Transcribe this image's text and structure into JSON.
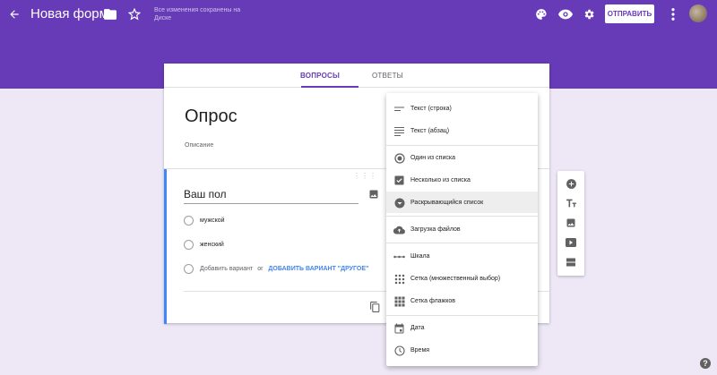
{
  "header": {
    "title": "Новая форма",
    "saved_status": "Все изменения сохранены на Диске",
    "send_label": "ОТПРАВИТЬ"
  },
  "tabs": [
    {
      "label": "ВОПРОСЫ",
      "active": true
    },
    {
      "label": "ОТВЕТЫ",
      "active": false
    }
  ],
  "form": {
    "title": "Опрос",
    "description_placeholder": "Описание"
  },
  "question": {
    "title": "Ваш пол",
    "options": [
      "мужской",
      "женский"
    ],
    "add_option": "Добавить вариант",
    "or": "or",
    "add_other": "ДОБАВИТЬ ВАРИАНТ \"ДРУГОЕ\""
  },
  "menu": {
    "items": [
      {
        "label": "Текст (строка)",
        "icon": "short-text-icon"
      },
      {
        "label": "Текст (абзац)",
        "icon": "paragraph-icon"
      },
      {
        "label": "Один из списка",
        "icon": "radio-button-icon"
      },
      {
        "label": "Несколько из списка",
        "icon": "checkbox-icon"
      },
      {
        "label": "Раскрывающийся список",
        "icon": "dropdown-icon",
        "active": true
      },
      {
        "label": "Загрузка файлов",
        "icon": "cloud-upload-icon"
      },
      {
        "label": "Шкала",
        "icon": "linear-scale-icon"
      },
      {
        "label": "Сетка (множественный выбор)",
        "icon": "grid-icon"
      },
      {
        "label": "Сетка флажков",
        "icon": "checkbox-grid-icon"
      },
      {
        "label": "Дата",
        "icon": "calendar-icon"
      },
      {
        "label": "Время",
        "icon": "clock-icon"
      }
    ]
  },
  "sidebar": {
    "icons": [
      "add-question-icon",
      "title-text-icon",
      "image-icon",
      "video-icon",
      "section-icon"
    ]
  },
  "colors": {
    "brand": "#673ab7",
    "background": "#ede7f6",
    "accent_blue": "#4285f4"
  }
}
